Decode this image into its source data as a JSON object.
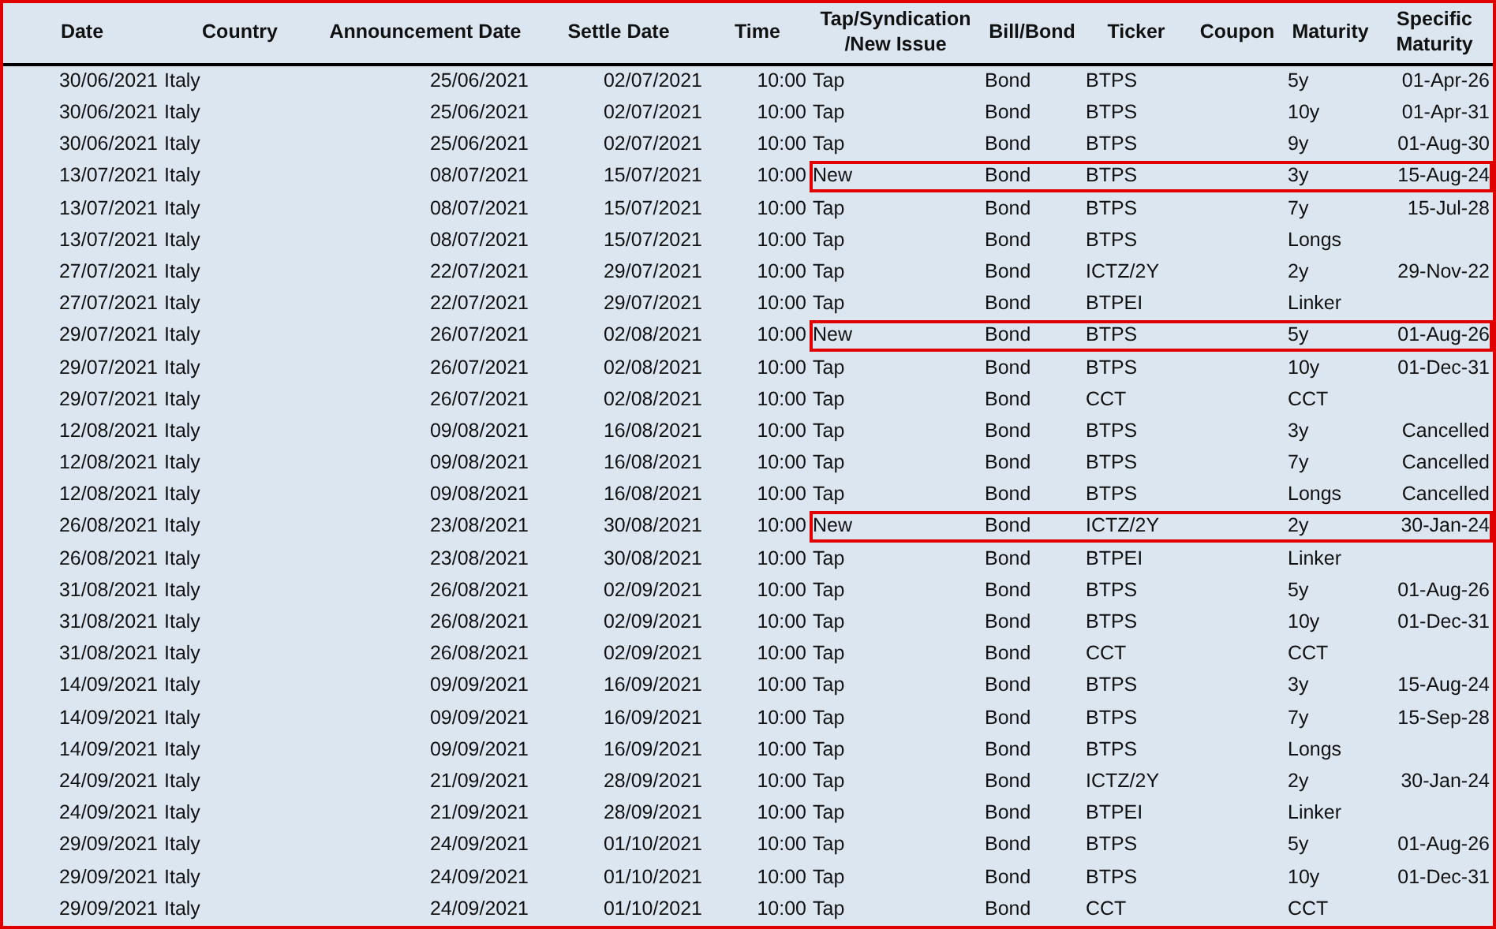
{
  "table": {
    "columns": [
      {
        "label": "Date"
      },
      {
        "label": "Country"
      },
      {
        "label": "Announcement Date"
      },
      {
        "label": "Settle Date"
      },
      {
        "label": "Time"
      },
      {
        "label": "Tap/Syndication /New Issue"
      },
      {
        "label": "Bill/Bond"
      },
      {
        "label": "Ticker"
      },
      {
        "label": "Coupon"
      },
      {
        "label": "Maturity"
      },
      {
        "label": "Specific Maturity"
      }
    ],
    "rows": [
      {
        "date": "30/06/2021",
        "country": "Italy",
        "announcement_date": "25/06/2021",
        "settle_date": "02/07/2021",
        "time": "10:00",
        "issue_type": "Tap",
        "bill_bond": "Bond",
        "ticker": "BTPS",
        "maturity": "5y",
        "specific_maturity": "01-Apr-26",
        "highlighted": false
      },
      {
        "date": "30/06/2021",
        "country": "Italy",
        "announcement_date": "25/06/2021",
        "settle_date": "02/07/2021",
        "time": "10:00",
        "issue_type": "Tap",
        "bill_bond": "Bond",
        "ticker": "BTPS",
        "maturity": "10y",
        "specific_maturity": "01-Apr-31",
        "highlighted": false
      },
      {
        "date": "30/06/2021",
        "country": "Italy",
        "announcement_date": "25/06/2021",
        "settle_date": "02/07/2021",
        "time": "10:00",
        "issue_type": "Tap",
        "bill_bond": "Bond",
        "ticker": "BTPS",
        "maturity": "9y",
        "specific_maturity": "01-Aug-30",
        "highlighted": false
      },
      {
        "date": "13/07/2021",
        "country": "Italy",
        "announcement_date": "08/07/2021",
        "settle_date": "15/07/2021",
        "time": "10:00",
        "issue_type": "New",
        "bill_bond": "Bond",
        "ticker": "BTPS",
        "maturity": "3y",
        "specific_maturity": "15-Aug-24",
        "highlighted": true
      },
      {
        "date": "13/07/2021",
        "country": "Italy",
        "announcement_date": "08/07/2021",
        "settle_date": "15/07/2021",
        "time": "10:00",
        "issue_type": "Tap",
        "bill_bond": "Bond",
        "ticker": "BTPS",
        "maturity": "7y",
        "specific_maturity": "15-Jul-28",
        "highlighted": false
      },
      {
        "date": "13/07/2021",
        "country": "Italy",
        "announcement_date": "08/07/2021",
        "settle_date": "15/07/2021",
        "time": "10:00",
        "issue_type": "Tap",
        "bill_bond": "Bond",
        "ticker": "BTPS",
        "maturity": "Longs",
        "highlighted": false
      },
      {
        "date": "27/07/2021",
        "country": "Italy",
        "announcement_date": "22/07/2021",
        "settle_date": "29/07/2021",
        "time": "10:00",
        "issue_type": "Tap",
        "bill_bond": "Bond",
        "ticker": "ICTZ/2Y",
        "maturity": "2y",
        "specific_maturity": "29-Nov-22",
        "highlighted": false
      },
      {
        "date": "27/07/2021",
        "country": "Italy",
        "announcement_date": "22/07/2021",
        "settle_date": "29/07/2021",
        "time": "10:00",
        "issue_type": "Tap",
        "bill_bond": "Bond",
        "ticker": "BTPEI",
        "maturity": "Linker",
        "highlighted": false
      },
      {
        "date": "29/07/2021",
        "country": "Italy",
        "announcement_date": "26/07/2021",
        "settle_date": "02/08/2021",
        "time": "10:00",
        "issue_type": "New",
        "bill_bond": "Bond",
        "ticker": "BTPS",
        "maturity": "5y",
        "specific_maturity": "01-Aug-26",
        "highlighted": true
      },
      {
        "date": "29/07/2021",
        "country": "Italy",
        "announcement_date": "26/07/2021",
        "settle_date": "02/08/2021",
        "time": "10:00",
        "issue_type": "Tap",
        "bill_bond": "Bond",
        "ticker": "BTPS",
        "maturity": "10y",
        "specific_maturity": "01-Dec-31",
        "highlighted": false
      },
      {
        "date": "29/07/2021",
        "country": "Italy",
        "announcement_date": "26/07/2021",
        "settle_date": "02/08/2021",
        "time": "10:00",
        "issue_type": "Tap",
        "bill_bond": "Bond",
        "ticker": "CCT",
        "maturity": "CCT",
        "highlighted": false
      },
      {
        "date": "12/08/2021",
        "country": "Italy",
        "announcement_date": "09/08/2021",
        "settle_date": "16/08/2021",
        "time": "10:00",
        "issue_type": "Tap",
        "bill_bond": "Bond",
        "ticker": "BTPS",
        "maturity": "3y",
        "specific_maturity": "Cancelled",
        "highlighted": false
      },
      {
        "date": "12/08/2021",
        "country": "Italy",
        "announcement_date": "09/08/2021",
        "settle_date": "16/08/2021",
        "time": "10:00",
        "issue_type": "Tap",
        "bill_bond": "Bond",
        "ticker": "BTPS",
        "maturity": "7y",
        "specific_maturity": "Cancelled",
        "highlighted": false
      },
      {
        "date": "12/08/2021",
        "country": "Italy",
        "announcement_date": "09/08/2021",
        "settle_date": "16/08/2021",
        "time": "10:00",
        "issue_type": "Tap",
        "bill_bond": "Bond",
        "ticker": "BTPS",
        "maturity": "Longs",
        "specific_maturity": "Cancelled",
        "highlighted": false
      },
      {
        "date": "26/08/2021",
        "country": "Italy",
        "announcement_date": "23/08/2021",
        "settle_date": "30/08/2021",
        "time": "10:00",
        "issue_type": "New",
        "bill_bond": "Bond",
        "ticker": "ICTZ/2Y",
        "maturity": "2y",
        "specific_maturity": "30-Jan-24",
        "highlighted": true
      },
      {
        "date": "26/08/2021",
        "country": "Italy",
        "announcement_date": "23/08/2021",
        "settle_date": "30/08/2021",
        "time": "10:00",
        "issue_type": "Tap",
        "bill_bond": "Bond",
        "ticker": "BTPEI",
        "maturity": "Linker",
        "highlighted": false
      },
      {
        "date": "31/08/2021",
        "country": "Italy",
        "announcement_date": "26/08/2021",
        "settle_date": "02/09/2021",
        "time": "10:00",
        "issue_type": "Tap",
        "bill_bond": "Bond",
        "ticker": "BTPS",
        "maturity": "5y",
        "specific_maturity": "01-Aug-26",
        "highlighted": false
      },
      {
        "date": "31/08/2021",
        "country": "Italy",
        "announcement_date": "26/08/2021",
        "settle_date": "02/09/2021",
        "time": "10:00",
        "issue_type": "Tap",
        "bill_bond": "Bond",
        "ticker": "BTPS",
        "maturity": "10y",
        "specific_maturity": "01-Dec-31",
        "highlighted": false
      },
      {
        "date": "31/08/2021",
        "country": "Italy",
        "announcement_date": "26/08/2021",
        "settle_date": "02/09/2021",
        "time": "10:00",
        "issue_type": "Tap",
        "bill_bond": "Bond",
        "ticker": "CCT",
        "maturity": "CCT",
        "highlighted": false
      },
      {
        "date": "14/09/2021",
        "country": "Italy",
        "announcement_date": "09/09/2021",
        "settle_date": "16/09/2021",
        "time": "10:00",
        "issue_type": "Tap",
        "bill_bond": "Bond",
        "ticker": "BTPS",
        "maturity": "3y",
        "specific_maturity": "15-Aug-24",
        "highlighted": false
      },
      {
        "date": "14/09/2021",
        "country": "Italy",
        "announcement_date": "09/09/2021",
        "settle_date": "16/09/2021",
        "time": "10:00",
        "issue_type": "Tap",
        "bill_bond": "Bond",
        "ticker": "BTPS",
        "maturity": "7y",
        "specific_maturity": "15-Sep-28",
        "highlighted": false
      },
      {
        "date": "14/09/2021",
        "country": "Italy",
        "announcement_date": "09/09/2021",
        "settle_date": "16/09/2021",
        "time": "10:00",
        "issue_type": "Tap",
        "bill_bond": "Bond",
        "ticker": "BTPS",
        "maturity": "Longs",
        "highlighted": false
      },
      {
        "date": "24/09/2021",
        "country": "Italy",
        "announcement_date": "21/09/2021",
        "settle_date": "28/09/2021",
        "time": "10:00",
        "issue_type": "Tap",
        "bill_bond": "Bond",
        "ticker": "ICTZ/2Y",
        "maturity": "2y",
        "specific_maturity": "30-Jan-24",
        "highlighted": false
      },
      {
        "date": "24/09/2021",
        "country": "Italy",
        "announcement_date": "21/09/2021",
        "settle_date": "28/09/2021",
        "time": "10:00",
        "issue_type": "Tap",
        "bill_bond": "Bond",
        "ticker": "BTPEI",
        "maturity": "Linker",
        "highlighted": false
      },
      {
        "date": "29/09/2021",
        "country": "Italy",
        "announcement_date": "24/09/2021",
        "settle_date": "01/10/2021",
        "time": "10:00",
        "issue_type": "Tap",
        "bill_bond": "Bond",
        "ticker": "BTPS",
        "maturity": "5y",
        "specific_maturity": "01-Aug-26",
        "highlighted": false
      },
      {
        "date": "29/09/2021",
        "country": "Italy",
        "announcement_date": "24/09/2021",
        "settle_date": "01/10/2021",
        "time": "10:00",
        "issue_type": "Tap",
        "bill_bond": "Bond",
        "ticker": "BTPS",
        "maturity": "10y",
        "specific_maturity": "01-Dec-31",
        "highlighted": false
      },
      {
        "date": "29/09/2021",
        "country": "Italy",
        "announcement_date": "24/09/2021",
        "settle_date": "01/10/2021",
        "time": "10:00",
        "issue_type": "Tap",
        "bill_bond": "Bond",
        "ticker": "CCT",
        "maturity": "CCT",
        "highlighted": false
      }
    ]
  }
}
